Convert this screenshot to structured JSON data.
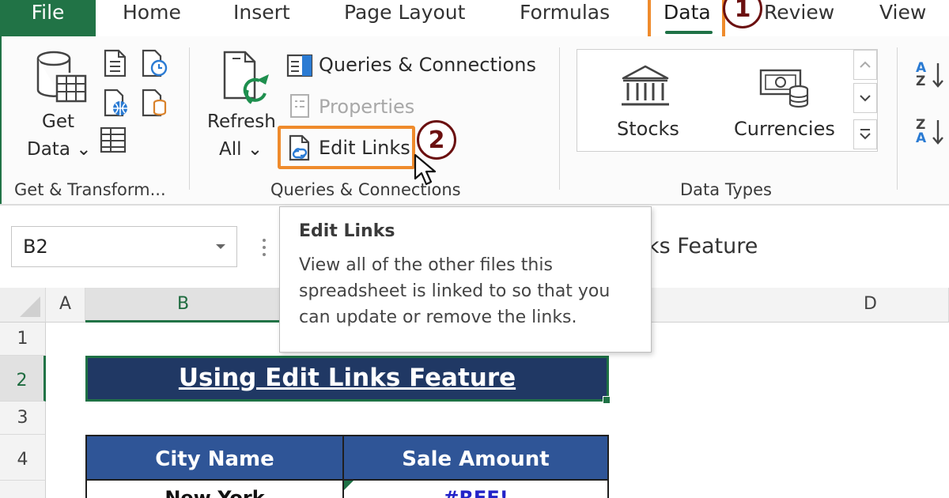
{
  "tabs": {
    "file": "File",
    "home": "Home",
    "insert": "Insert",
    "page_layout": "Page Layout",
    "formulas": "Formulas",
    "data": "Data",
    "review": "Review",
    "view": "View"
  },
  "annotations": {
    "step1": "1",
    "step2": "2"
  },
  "ribbon": {
    "get_transform": {
      "get_data_line1": "Get",
      "get_data_line2": "Data ⌄",
      "group_label": "Get & Transform..."
    },
    "queries": {
      "refresh_line1": "Refresh",
      "refresh_line2": "All ⌄",
      "queries_connections": "Queries & Connections",
      "properties": "Properties",
      "edit_links": "Edit Links",
      "group_label": "Queries & Connections"
    },
    "data_types": {
      "stocks": "Stocks",
      "currencies": "Currencies",
      "group_label": "Data Types"
    },
    "sort": {
      "az_top": "A",
      "az_bottom": "Z",
      "za_top": "Z",
      "za_bottom": "A"
    }
  },
  "formula_bar": {
    "name_box": "B2",
    "formula_text": "ks Feature"
  },
  "grid": {
    "columns": [
      "A",
      "B",
      "D"
    ],
    "rows": [
      "1",
      "2",
      "3",
      "4"
    ],
    "title": "Using Edit Links Feature",
    "headers": [
      "City Name",
      "Sale Amount"
    ],
    "first_row_partial": [
      "New York",
      "#REF!"
    ]
  },
  "tooltip": {
    "title": "Edit Links",
    "body": "View all of the other files this spreadsheet is linked to so that you can update or remove the links."
  },
  "colors": {
    "excel_green": "#217346",
    "highlight_orange": "#ef8b2c",
    "marker_red": "#6b1010",
    "title_fill": "#203864",
    "header_fill": "#2f5597"
  }
}
